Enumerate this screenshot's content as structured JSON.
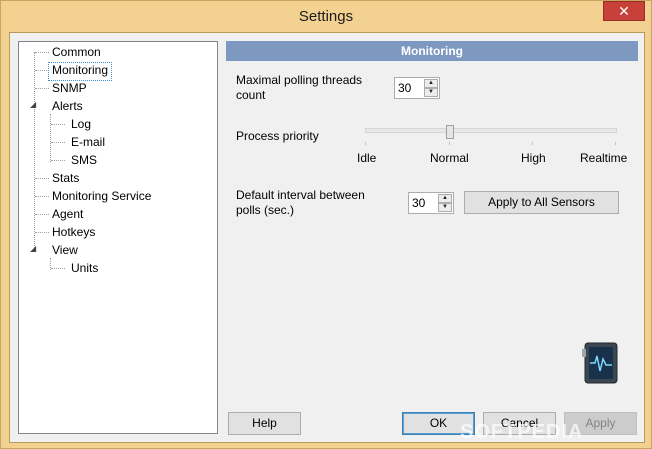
{
  "window": {
    "title": "Settings",
    "close_glyph": "✕"
  },
  "tree": {
    "items": [
      {
        "label": "Common"
      },
      {
        "label": "Monitoring"
      },
      {
        "label": "SNMP"
      },
      {
        "label": "Alerts"
      },
      {
        "label": "Log"
      },
      {
        "label": "E-mail"
      },
      {
        "label": "SMS"
      },
      {
        "label": "Stats"
      },
      {
        "label": "Monitoring Service"
      },
      {
        "label": "Agent"
      },
      {
        "label": "Hotkeys"
      },
      {
        "label": "View"
      },
      {
        "label": "Units"
      }
    ],
    "selected": "Monitoring"
  },
  "panel": {
    "header": "Monitoring",
    "threads_label": "Maximal polling threads count",
    "threads_value": "30",
    "priority_label": "Process priority",
    "priority_options": [
      "Idle",
      "Normal",
      "High",
      "Realtime"
    ],
    "priority_selected": "Normal",
    "interval_label": "Default interval between polls (sec.)",
    "interval_value": "30",
    "apply_all_label": "Apply to All Sensors"
  },
  "footer": {
    "help_label": "Help",
    "ok_label": "OK",
    "cancel_label": "Cancel",
    "apply_label": "Apply"
  },
  "watermark": "SOFTPEDIA"
}
